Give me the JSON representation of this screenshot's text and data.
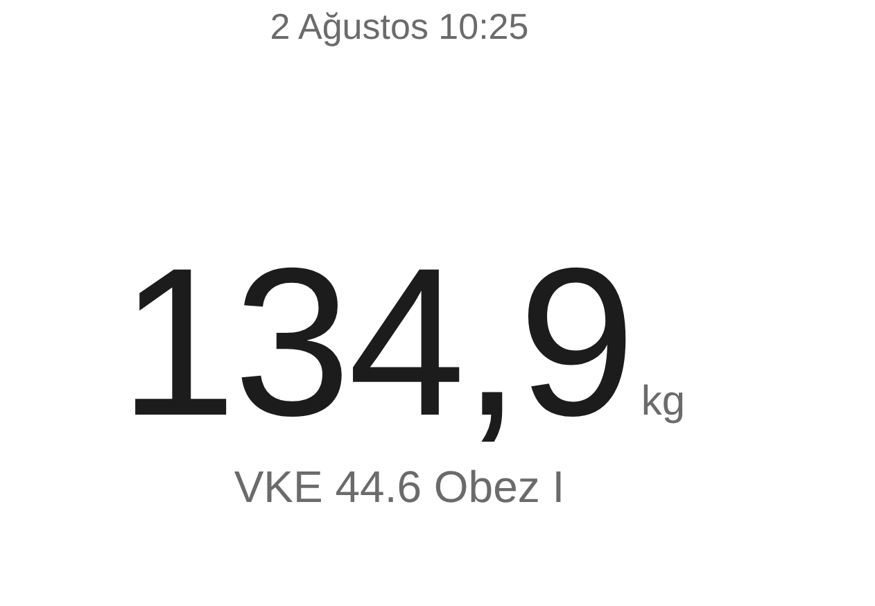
{
  "date": "2 Ağustos 10:25",
  "weight": {
    "value": "134,9",
    "unit": "kg"
  },
  "bmi_label": "VKE 44.6 Obez I"
}
